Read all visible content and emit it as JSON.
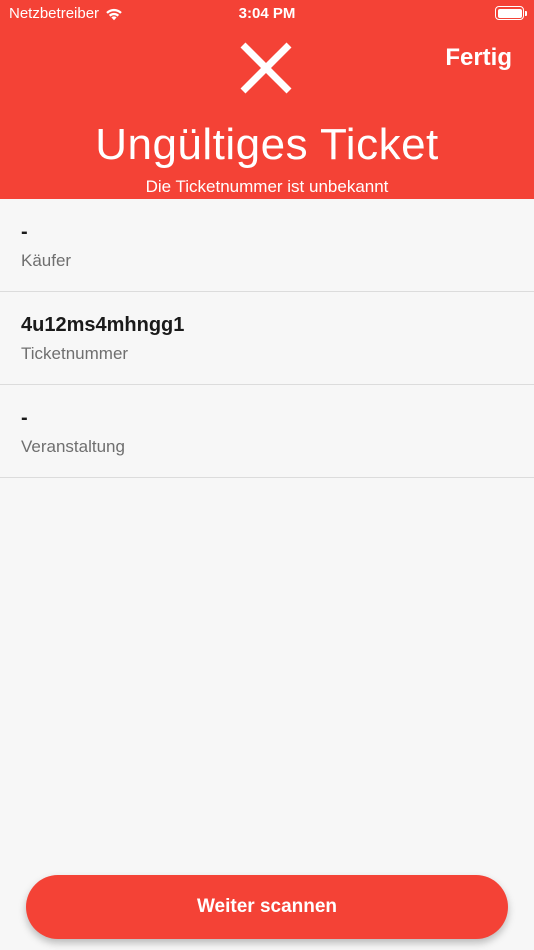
{
  "status_bar": {
    "carrier": "Netzbetreiber",
    "time": "3:04 PM",
    "wifi_icon": "wifi-icon",
    "battery_icon": "battery-icon"
  },
  "header": {
    "done_label": "Fertig",
    "status_icon": "close-icon",
    "title": "Ungültiges Ticket",
    "subtitle": "Die Ticketnummer ist unbekannt",
    "background_color": "#f44236"
  },
  "details": [
    {
      "value": "-",
      "label": "Käufer"
    },
    {
      "value": "4u12ms4mhngg1",
      "label": "Ticketnummer"
    },
    {
      "value": "-",
      "label": "Veranstaltung"
    }
  ],
  "footer": {
    "scan_button_label": "Weiter scannen",
    "button_color": "#f44236"
  }
}
